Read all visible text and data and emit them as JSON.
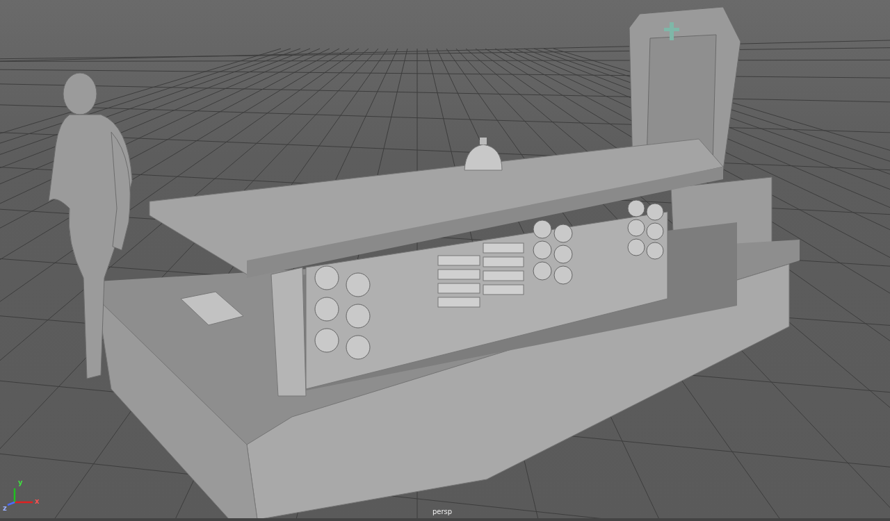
{
  "viewport": {
    "camera_label": "persp",
    "axes": [
      "x",
      "y",
      "z"
    ]
  }
}
